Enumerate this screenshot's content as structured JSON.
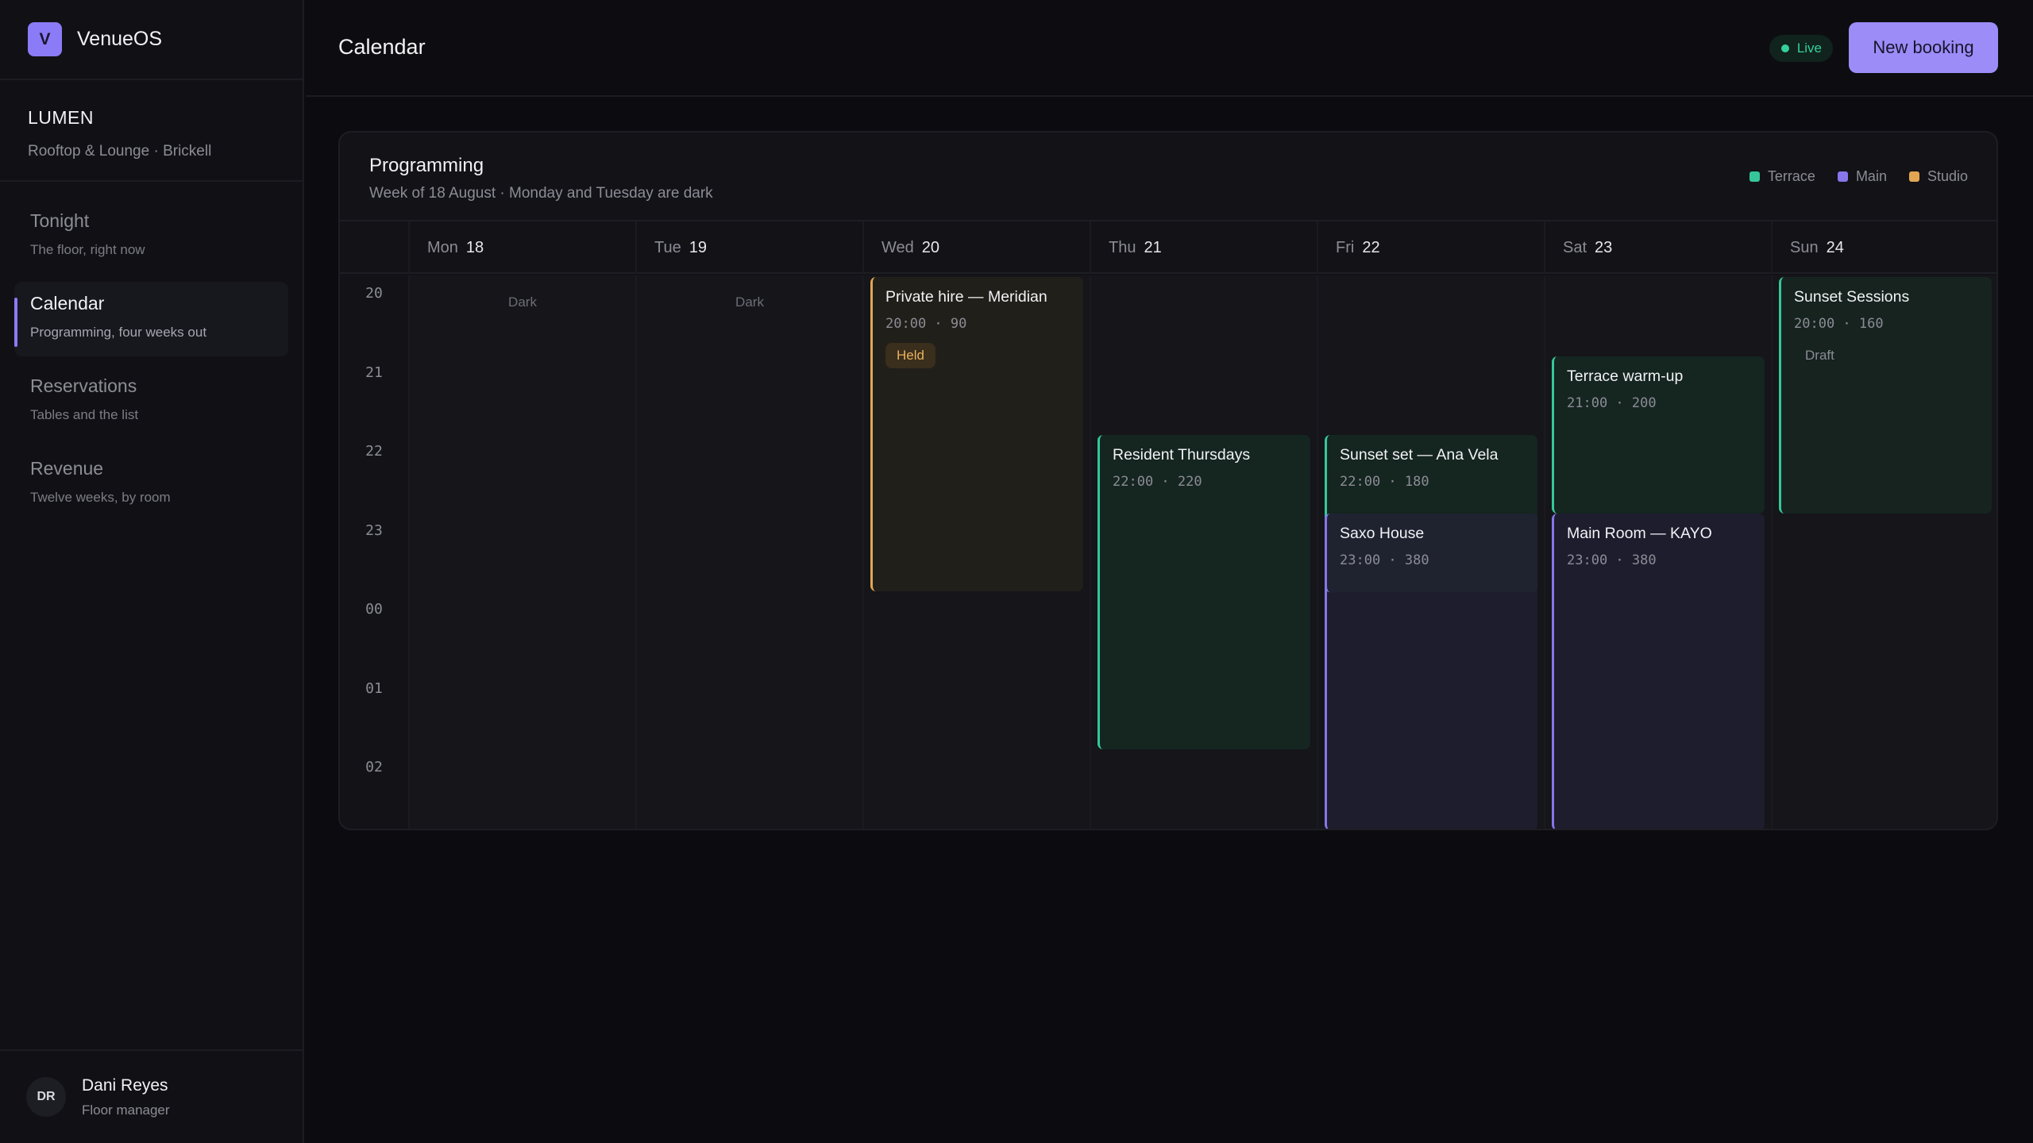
{
  "brand": {
    "logo_letter": "V",
    "name": "VenueOS"
  },
  "venue": {
    "name": "LUMEN",
    "subtitle": "Rooftop & Lounge · Brickell"
  },
  "nav": [
    {
      "label": "Tonight",
      "sub": "The floor, right now",
      "active": false
    },
    {
      "label": "Calendar",
      "sub": "Programming, four weeks out",
      "active": true
    },
    {
      "label": "Reservations",
      "sub": "Tables and the list",
      "active": false
    },
    {
      "label": "Revenue",
      "sub": "Twelve weeks, by room",
      "active": false
    }
  ],
  "user": {
    "initials": "DR",
    "name": "Dani Reyes",
    "role": "Floor manager"
  },
  "topbar": {
    "title": "Calendar",
    "status": "Live",
    "new_button": "New booking"
  },
  "card": {
    "title": "Programming",
    "subtitle": "Week of 18 August · Monday and Tuesday are dark",
    "legend": [
      {
        "label": "Terrace",
        "color": "#35c79a"
      },
      {
        "label": "Main",
        "color": "#8676ea"
      },
      {
        "label": "Studio",
        "color": "#e2a653"
      }
    ]
  },
  "days": [
    {
      "name": "Mon",
      "num": "18",
      "dark_label": "Dark"
    },
    {
      "name": "Tue",
      "num": "19",
      "dark_label": "Dark"
    },
    {
      "name": "Wed",
      "num": "20",
      "dark_label": ""
    },
    {
      "name": "Thu",
      "num": "21",
      "dark_label": ""
    },
    {
      "name": "Fri",
      "num": "22",
      "dark_label": ""
    },
    {
      "name": "Sat",
      "num": "23",
      "dark_label": ""
    },
    {
      "name": "Sun",
      "num": "24",
      "dark_label": ""
    }
  ],
  "hours": [
    "20",
    "21",
    "22",
    "23",
    "00",
    "01",
    "02"
  ],
  "events": [
    {
      "title": "Private hire — Meridian",
      "time": "20:00",
      "capacity": "90",
      "room": "studio",
      "status": "Held"
    },
    {
      "title": "Resident Thursdays",
      "time": "22:00",
      "capacity": "220",
      "room": "terrace",
      "status": ""
    },
    {
      "title": "Sunset set — Ana Vela",
      "time": "22:00",
      "capacity": "180",
      "room": "terrace",
      "status": ""
    },
    {
      "title": "Saxo House",
      "time": "23:00",
      "capacity": "380",
      "room": "main",
      "status": ""
    },
    {
      "title": "Terrace warm-up",
      "time": "21:00",
      "capacity": "200",
      "room": "terrace",
      "status": ""
    },
    {
      "title": "Main Room — KAYO",
      "time": "23:00",
      "capacity": "380",
      "room": "main",
      "status": ""
    },
    {
      "title": "Sunset Sessions",
      "time": "20:00",
      "capacity": "160",
      "room": "terrace",
      "status": "Draft"
    }
  ]
}
